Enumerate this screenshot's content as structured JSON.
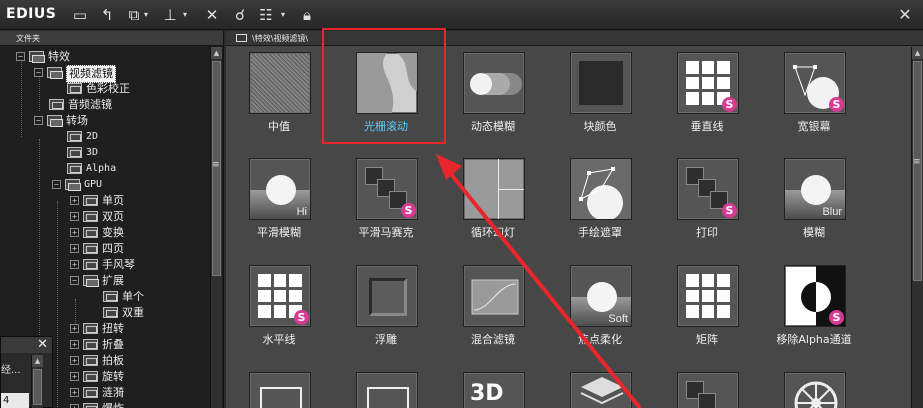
{
  "app": {
    "name": "EDIUS"
  },
  "toolbar": {
    "icons": [
      "folder-icon",
      "up-icon",
      "copy-icon",
      "timeline-icon",
      "delete-icon",
      "effect-icon",
      "view-icon",
      "lock-icon"
    ],
    "close": "✕"
  },
  "tree_panel": {
    "header": "文件夹",
    "items": [
      {
        "label": "特效"
      },
      {
        "label": "视频滤镜"
      },
      {
        "label": "色彩校正"
      },
      {
        "label": "音频滤镜"
      },
      {
        "label": "转场"
      },
      {
        "label": "2D"
      },
      {
        "label": "3D"
      },
      {
        "label": "Alpha"
      },
      {
        "label": "GPU"
      },
      {
        "label": "单页"
      },
      {
        "label": "双页"
      },
      {
        "label": "变换"
      },
      {
        "label": "四页"
      },
      {
        "label": "手风琴"
      },
      {
        "label": "扩展"
      },
      {
        "label": "单个"
      },
      {
        "label": "双重"
      },
      {
        "label": "扭转"
      },
      {
        "label": "折叠"
      },
      {
        "label": "拍板"
      },
      {
        "label": "旋转"
      },
      {
        "label": "涟漪"
      },
      {
        "label": "爆炸"
      }
    ]
  },
  "mini_window": {
    "close": "✕",
    "row1": "经...",
    "row2": "4"
  },
  "fx_panel": {
    "path": "\\特效\\视频滤镜\\",
    "row1": [
      "中值",
      "光栅滚动",
      "动态模糊",
      "块颜色",
      "垂直线",
      "宽银幕"
    ],
    "row2": [
      "平滑模糊",
      "平滑马赛克",
      "循环幻灯",
      "手绘遮罩",
      "打印",
      "模糊"
    ],
    "row3": [
      "水平线",
      "浮雕",
      "混合滤镜",
      "焦点柔化",
      "矩阵",
      "移除Alpha通道"
    ],
    "active": "光栅滚动",
    "badge": "S",
    "captions": {
      "hi": "Hi",
      "blur": "Blur",
      "soft": "Soft",
      "three_d": "3D"
    }
  },
  "colors": {
    "highlight": "#e8262c",
    "active_label": "#5cc8ff",
    "badge": "#d63a93"
  }
}
